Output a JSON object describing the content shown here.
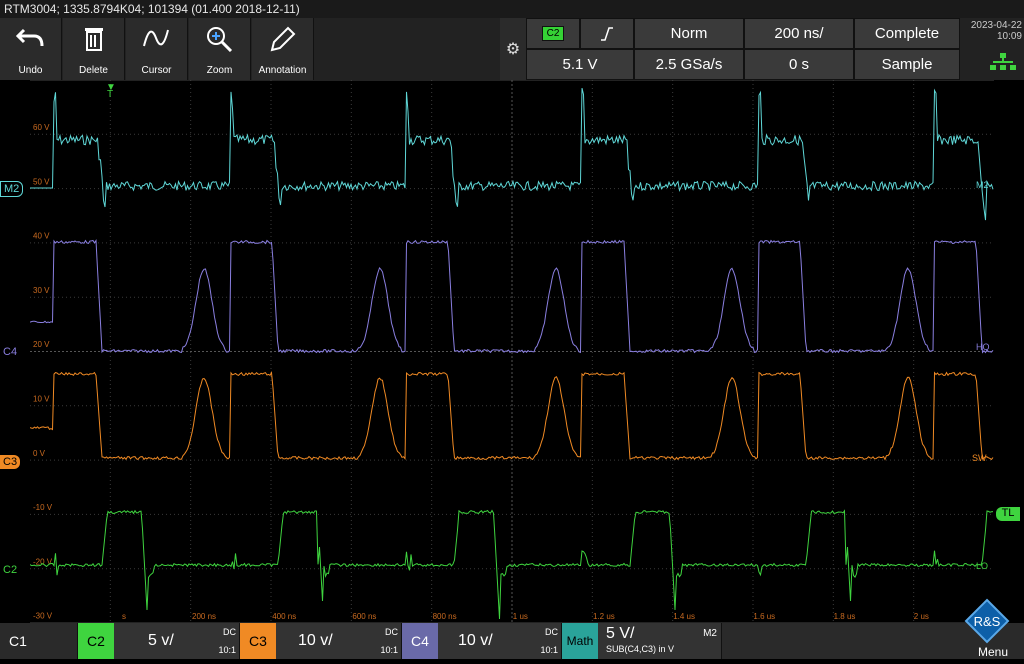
{
  "titlebar": "RTM3004; 1335.8794K04; 101394 (01.400 2018-12-11)",
  "toolbar": {
    "buttons": [
      {
        "label": "Undo",
        "icon": "undo-icon"
      },
      {
        "label": "Delete",
        "icon": "trash-icon"
      },
      {
        "label": "Cursor",
        "icon": "cursor-icon"
      },
      {
        "label": "Zoom",
        "icon": "zoom-icon"
      },
      {
        "label": "Annotation",
        "icon": "pencil-icon"
      }
    ]
  },
  "settings": {
    "channel": "C2",
    "slope_icon": "rising-edge-icon",
    "trigger_mode": "Norm",
    "timebase": "200 ns/",
    "acq_status": "Complete",
    "trigger_level": "5.1 V",
    "sample_rate": "2.5 GSa/s",
    "horiz_position": "0 s",
    "acq_mode": "Sample"
  },
  "datetime": {
    "date": "2023-04-22",
    "time": "10:09"
  },
  "axis": {
    "y_labels": [
      "60 V",
      "50 V",
      "40 V",
      "30 V",
      "20 V",
      "10 V",
      "0 V",
      "-10 V",
      "-20 V",
      "-30 V"
    ],
    "x_labels": [
      "200 ns",
      "400 ns",
      "600 ns",
      "800 ns",
      "1 us",
      "1.2 us",
      "1.4 us",
      "1.6 us",
      "1.8 us",
      "2 us"
    ],
    "x_label_first_fragment": "s"
  },
  "channel_labels": {
    "m2": "M2",
    "c4": "C4",
    "c3": "C3",
    "c2": "C2",
    "trigger": "T",
    "tl": "TL"
  },
  "right_labels": {
    "m2": "M2",
    "ho": "HO",
    "sw": "SW",
    "lo": "LO"
  },
  "bottom": {
    "c1": {
      "name": "C1"
    },
    "c2": {
      "name": "C2",
      "scale": "5 v/",
      "coupling": "DC",
      "probe": "10:1"
    },
    "c3": {
      "name": "C3",
      "scale": "10 v/",
      "coupling": "DC",
      "probe": "10:1"
    },
    "c4": {
      "name": "C4",
      "scale": "10 v/",
      "coupling": "DC",
      "probe": "10:1"
    },
    "math": {
      "name": "Math",
      "scale": "5 V/",
      "formula": "SUB(C4,C3) in V",
      "tag": "M2"
    },
    "menu": "Menu",
    "logo": "R&S"
  },
  "colors": {
    "m2": "#5fd7d7",
    "c4": "#8a7fe0",
    "c3": "#f08a24",
    "c2": "#3fd43f",
    "grid": "#3a3a3a",
    "axis_text": "#c86a20"
  }
}
